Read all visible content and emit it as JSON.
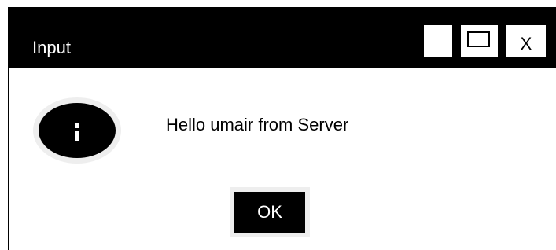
{
  "dialog": {
    "title": "Input",
    "close_label": "X",
    "message": "Hello umair from Server",
    "ok_label": "OK",
    "icon": "info-icon"
  },
  "colors": {
    "titlebar": "#000000",
    "background": "#ffffff",
    "button_halo": "#eeeeee"
  }
}
